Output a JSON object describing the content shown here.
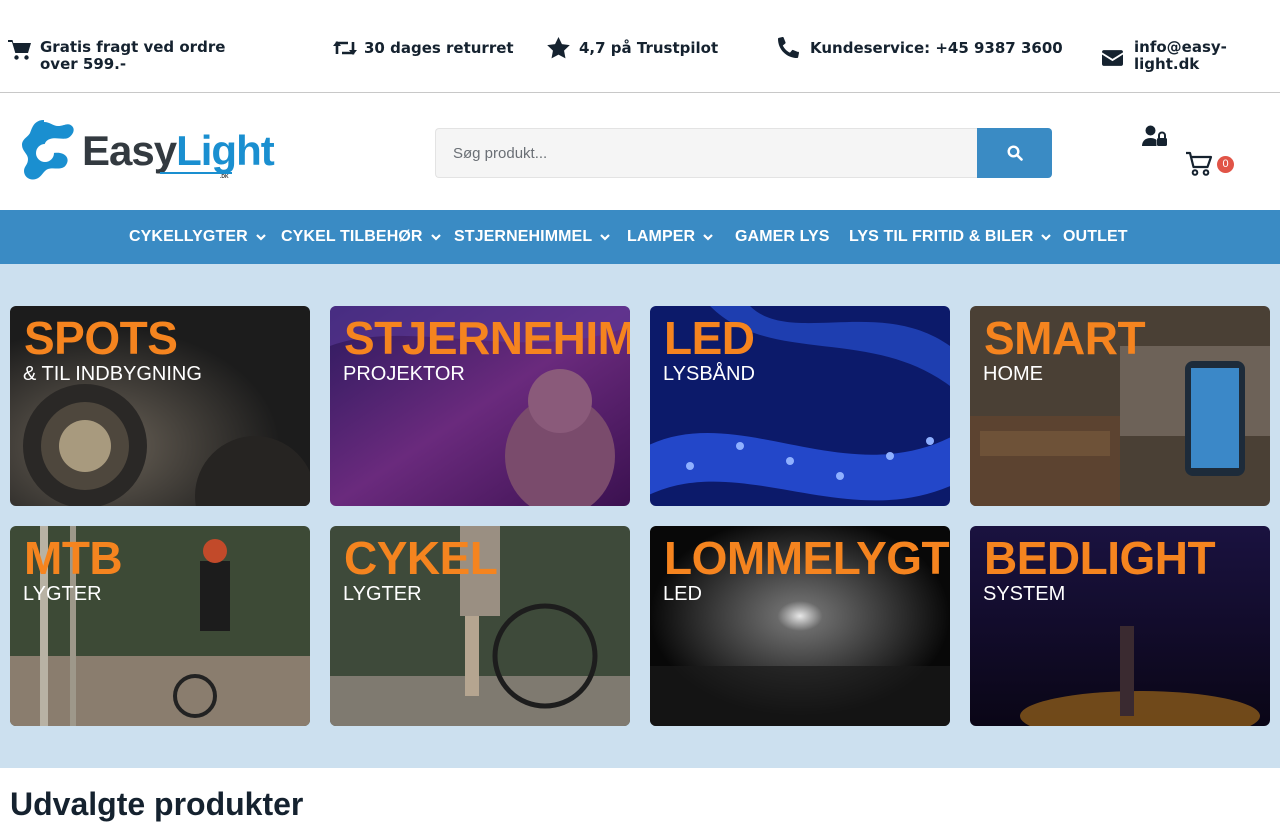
{
  "topbar": {
    "items": [
      {
        "icon": "cart-icon",
        "text": "Gratis fragt ved ordre over 599.-"
      },
      {
        "icon": "retweet-icon",
        "text": "30 dages returret"
      },
      {
        "icon": "star-icon",
        "text": "4,7 på Trustpilot"
      },
      {
        "icon": "phone-icon",
        "text": "Kundeservice: +45 9387 3600"
      },
      {
        "icon": "envelope-icon",
        "text": "info@easy-light.dk"
      }
    ]
  },
  "header": {
    "logo": {
      "part1": "Easy",
      "part2": "Light",
      "suffix": ".DK"
    },
    "search": {
      "placeholder": "Søg produkt...",
      "value": ""
    },
    "cart_count": "0"
  },
  "nav": {
    "items": [
      {
        "label": "CYKELLYGTER",
        "dropdown": true
      },
      {
        "label": "CYKEL TILBEHØR",
        "dropdown": true
      },
      {
        "label": "STJERNEHIMMEL",
        "dropdown": true
      },
      {
        "label": "LAMPER",
        "dropdown": true
      },
      {
        "label": "GAMER LYS",
        "dropdown": false
      },
      {
        "label": "LYS TIL FRITID & BILER",
        "dropdown": true
      },
      {
        "label": "OUTLET",
        "dropdown": false
      }
    ]
  },
  "categories": [
    {
      "title": "SPOTS",
      "subtitle": "& TIL INDBYGNING"
    },
    {
      "title": "STJERNEHIMMEL",
      "subtitle": "PROJEKTOR"
    },
    {
      "title": "LED",
      "subtitle": "LYSBÅND"
    },
    {
      "title": "SMART",
      "subtitle": "HOME"
    },
    {
      "title": "MTB",
      "subtitle": "LYGTER"
    },
    {
      "title": "CYKEL",
      "subtitle": "LYGTER"
    },
    {
      "title": "LOMMELYGTER",
      "subtitle": "LED"
    },
    {
      "title": "BEDLIGHT",
      "subtitle": "SYSTEM"
    }
  ],
  "featured": {
    "heading": "Udvalgte produkter"
  },
  "colors": {
    "primary": "#3a8bc4",
    "accent": "#f5841f",
    "grid_bg": "#cce0ef",
    "badge": "#e15447",
    "text": "#15222f"
  }
}
